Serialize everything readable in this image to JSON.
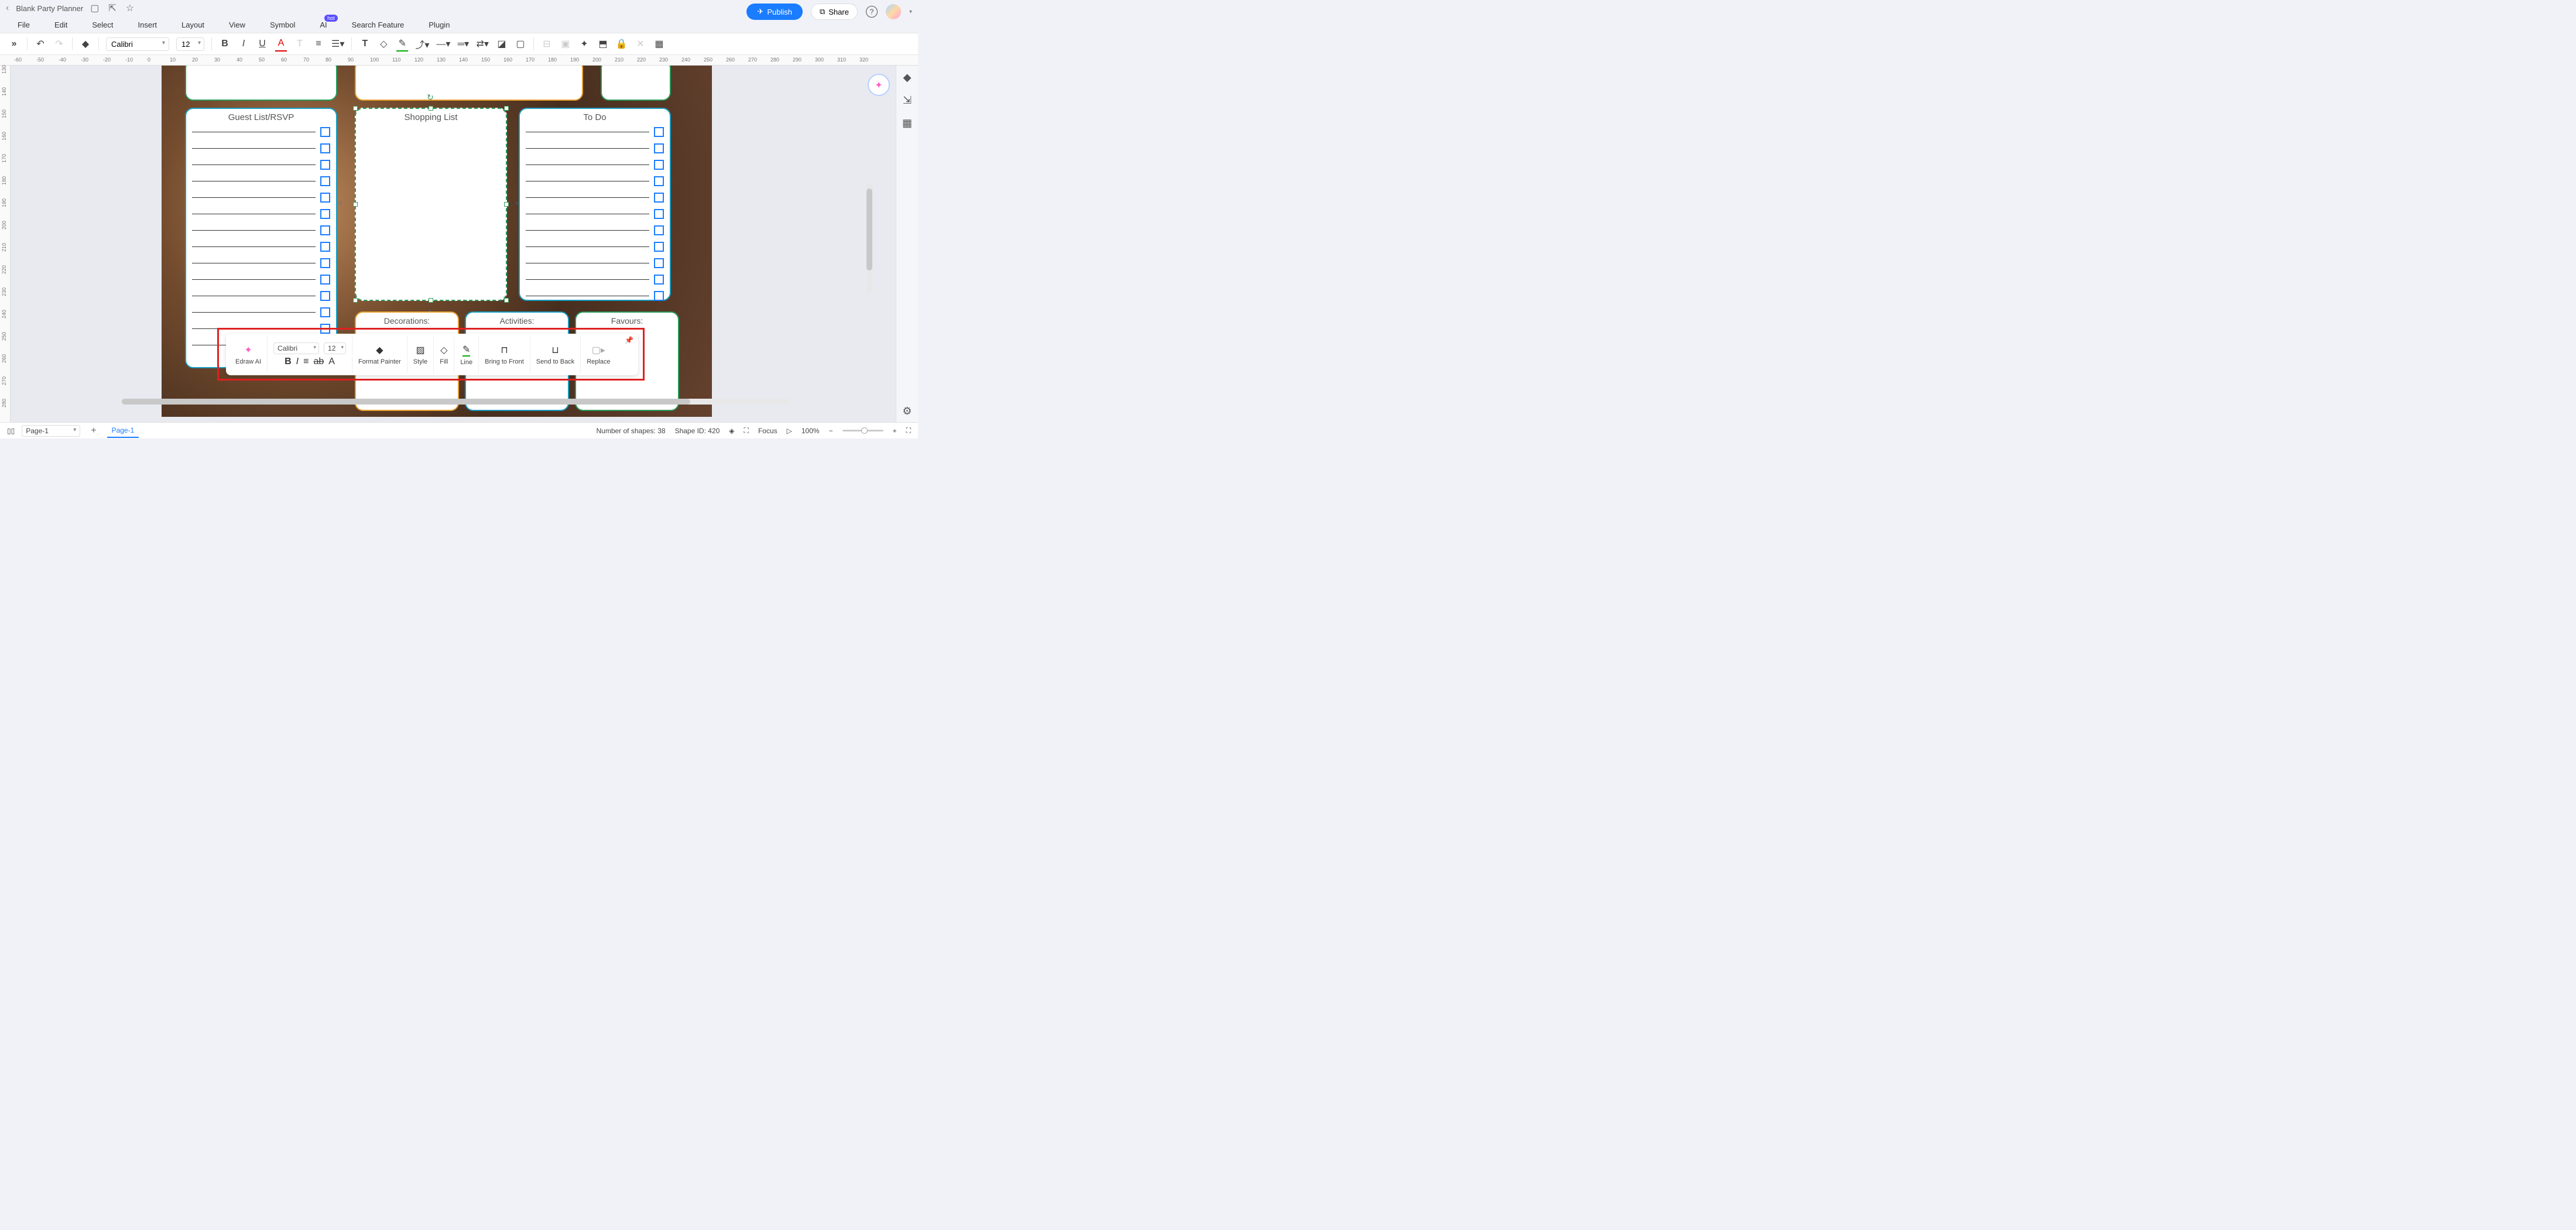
{
  "title_bar": {
    "title": "Blank Party Planner"
  },
  "menu": {
    "file": "File",
    "edit": "Edit",
    "select": "Select",
    "insert": "Insert",
    "layout": "Layout",
    "view": "View",
    "symbol": "Symbol",
    "ai": "AI",
    "ai_badge": "hot",
    "search": "Search Feature",
    "plugin": "Plugin"
  },
  "top_right": {
    "publish": "Publish",
    "share": "Share"
  },
  "toolbar": {
    "font": "Calibri",
    "size": "12"
  },
  "h_ruler": [
    "-60",
    "-50",
    "-40",
    "-30",
    "-20",
    "-10",
    "0",
    "10",
    "20",
    "30",
    "40",
    "50",
    "60",
    "70",
    "80",
    "90",
    "100",
    "110",
    "120",
    "130",
    "140",
    "150",
    "160",
    "170",
    "180",
    "190",
    "200",
    "210",
    "220",
    "230",
    "240",
    "250",
    "260",
    "270",
    "280",
    "290",
    "300",
    "310",
    "320"
  ],
  "v_ruler": [
    "130",
    "140",
    "150",
    "160",
    "170",
    "180",
    "190",
    "200",
    "210",
    "220",
    "230",
    "240",
    "250",
    "260",
    "270",
    "280"
  ],
  "cards": {
    "guest": "Guest List/RSVP",
    "shopping": "Shopping List",
    "todo": "To Do",
    "dec": "Decorations:",
    "act": "Activities:",
    "fav": "Favours:"
  },
  "float_tb": {
    "edraw_ai": "Edraw AI",
    "font": "Calibri",
    "size": "12",
    "format_painter": "Format Painter",
    "style": "Style",
    "fill": "Fill",
    "line": "Line",
    "bring_front": "Bring to Front",
    "send_back": "Send to Back",
    "replace": "Replace"
  },
  "status": {
    "page_sel": "Page-1",
    "page_tab": "Page-1",
    "shapes": "Number of shapes: 38",
    "shape_id": "Shape ID: 420",
    "focus": "Focus",
    "zoom": "100%"
  }
}
